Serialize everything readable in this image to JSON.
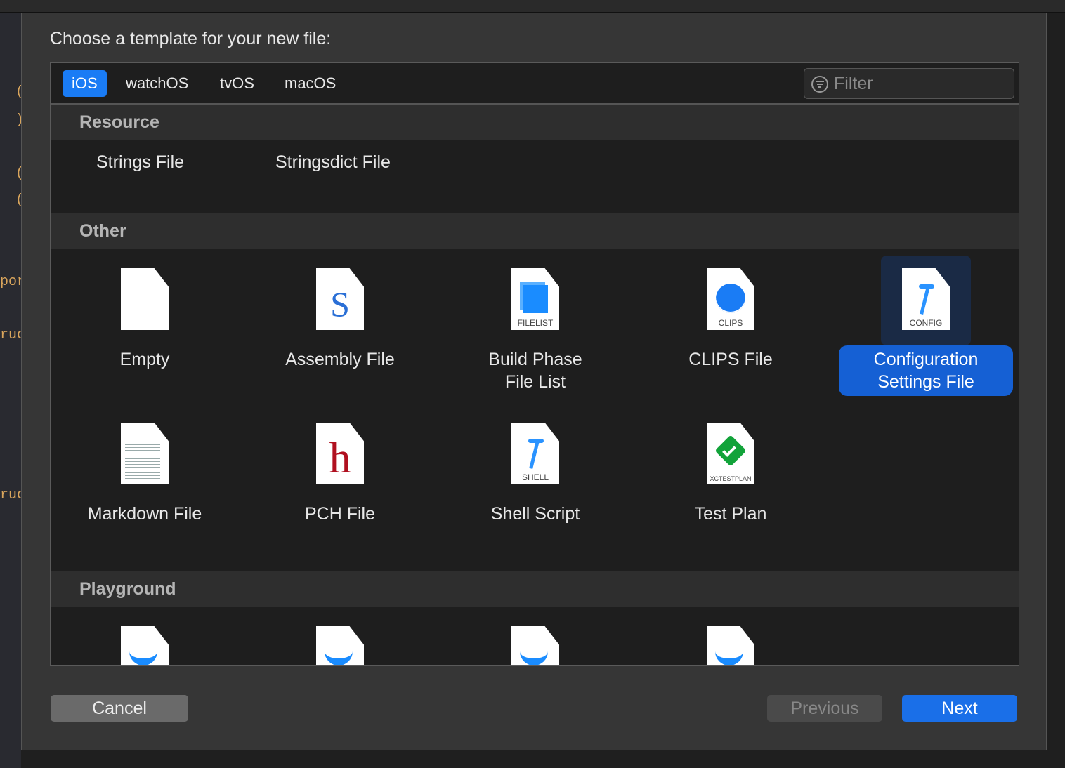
{
  "dialog": {
    "title": "Choose a template for your new file:"
  },
  "tabs": [
    {
      "label": "iOS",
      "active": true
    },
    {
      "label": "watchOS"
    },
    {
      "label": "tvOS"
    },
    {
      "label": "macOS"
    }
  ],
  "filter": {
    "placeholder": "Filter",
    "value": ""
  },
  "sections": [
    {
      "title": "Resource",
      "items": [
        {
          "label": "Strings File"
        },
        {
          "label": "Stringsdict File"
        }
      ]
    },
    {
      "title": "Other",
      "items": [
        {
          "label": "Empty",
          "icon": "empty-doc-icon"
        },
        {
          "label": "Assembly File",
          "icon": "assembly-s-icon",
          "badge": "S"
        },
        {
          "label": "Build Phase File List",
          "icon": "filelist-icon",
          "badge": "FILELIST"
        },
        {
          "label": "CLIPS File",
          "icon": "clips-icon",
          "badge": "CLIPS"
        },
        {
          "label": "Configuration Settings File",
          "icon": "config-hammer-icon",
          "badge": "CONFIG",
          "selected": true
        },
        {
          "label": "Markdown File",
          "icon": "markdown-icon"
        },
        {
          "label": "PCH File",
          "icon": "pch-h-icon",
          "badge": "h"
        },
        {
          "label": "Shell Script",
          "icon": "shell-hammer-icon",
          "badge": "SHELL"
        },
        {
          "label": "Test Plan",
          "icon": "xctestplan-icon",
          "badge": "XCTESTPLAN"
        }
      ]
    },
    {
      "title": "Playground",
      "items": [
        {
          "icon": "swift-icon"
        },
        {
          "icon": "swift-icon"
        },
        {
          "icon": "swift-icon"
        },
        {
          "icon": "swift-icon"
        }
      ]
    }
  ],
  "buttons": {
    "cancel": "Cancel",
    "previous": "Previous",
    "next": "Next"
  },
  "colors": {
    "accent": "#1a7cf5",
    "selection": "#1560d4"
  }
}
